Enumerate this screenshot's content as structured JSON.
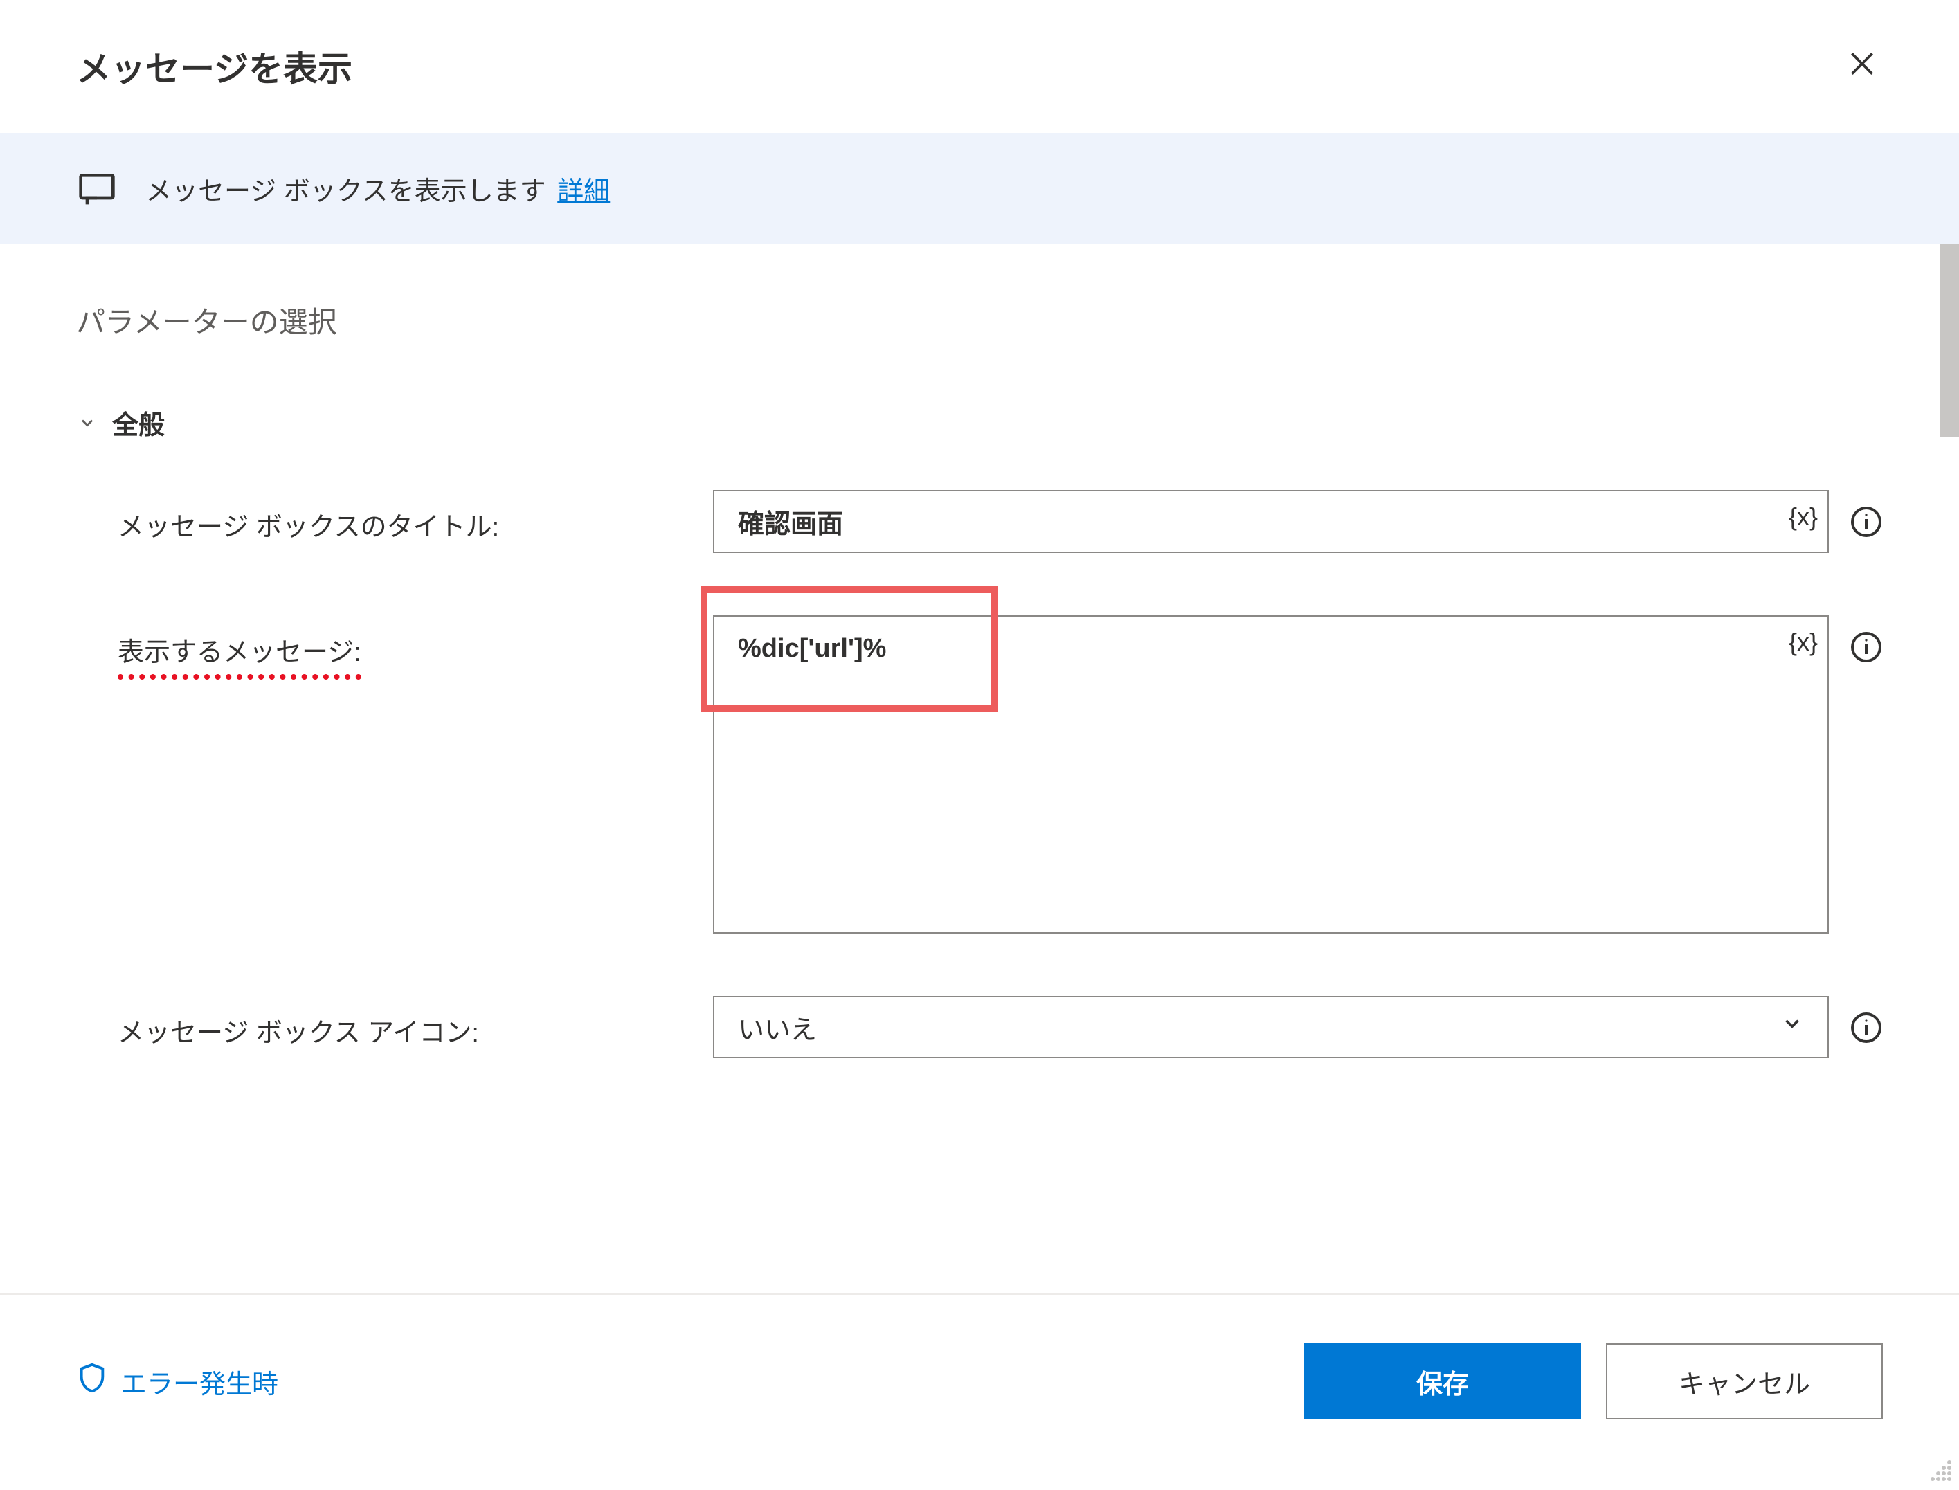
{
  "dialog": {
    "title": "メッセージを表示"
  },
  "banner": {
    "text": "メッセージ ボックスを表示します",
    "link": "詳細"
  },
  "section": {
    "title": "パラメーターの選択",
    "group_label": "全般"
  },
  "fields": {
    "title_label": "メッセージ ボックスのタイトル:",
    "title_value": "確認画面",
    "message_label": "表示するメッセージ:",
    "message_value": "%dic['url']%",
    "icon_label": "メッセージ ボックス アイコン:",
    "icon_value": "いいえ",
    "var_token": "{x}"
  },
  "footer": {
    "error_link": "エラー発生時",
    "save": "保存",
    "cancel": "キャンセル"
  }
}
